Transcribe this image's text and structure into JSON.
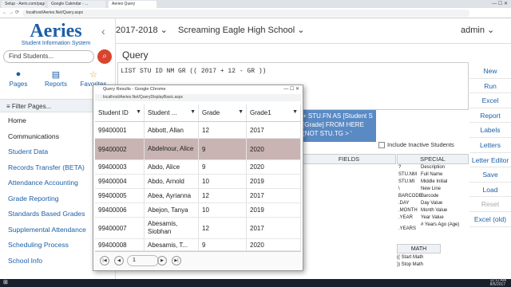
{
  "browser": {
    "tabs": [
      "Setup - Aeris.com/pages/...",
      "Google Calendar - ...",
      "Aeries Query"
    ],
    "url": "localhost/Aeries.Net/Query.aspx"
  },
  "sidebar": {
    "logo": "Aeries",
    "logo_sub": "Student Information System",
    "find_placeholder": "Find Students...",
    "quick": [
      {
        "label": "Pages"
      },
      {
        "label": "Reports"
      },
      {
        "label": "Favorites"
      }
    ],
    "filter_label": "Filter Pages...",
    "items": [
      {
        "label": "Home"
      },
      {
        "label": "Communications"
      },
      {
        "label": "Student Data"
      },
      {
        "label": "Records Transfer (BETA)"
      },
      {
        "label": "Attendance Accounting"
      },
      {
        "label": "Grade Reporting"
      },
      {
        "label": "Standards Based Grades"
      },
      {
        "label": "Supplemental Attendance"
      },
      {
        "label": "Scheduling Process"
      },
      {
        "label": "School Info"
      }
    ]
  },
  "topbar": {
    "year": "2017-2018",
    "school": "Screaming Eagle High School",
    "user": "admin"
  },
  "query": {
    "title": "Query",
    "text": "LIST STU ID NM GR (( 2017 + 12 - GR ))",
    "partial": "+ STU.FN AS [Student S [Grade] FROM HERE (NOT STU.TG > '",
    "include_inactive": "Include Inactive Students",
    "fields_header": "FIELDS",
    "special_header": "SPECIAL",
    "special": [
      {
        "k": "?",
        "v": "Description"
      },
      {
        "k": "STU.NM",
        "v": "Full Name"
      },
      {
        "k": "STU.MI",
        "v": "Middle Initial"
      },
      {
        "k": "\\",
        "v": "New Line"
      },
      {
        "k": "BARCODE",
        "v": "Barcode"
      },
      {
        "k": ".DAY",
        "v": "Day Value"
      },
      {
        "k": ".MONTH",
        "v": "Month Value"
      },
      {
        "k": ".YEAR",
        "v": "Year Value"
      },
      {
        "k": ".YEARS",
        "v": "# Years Ago (Age)"
      }
    ],
    "math_header": "MATH",
    "math": [
      "(( Start Math",
      ")) Stop Math"
    ]
  },
  "buttons": [
    "New",
    "Run",
    "Excel",
    "Report",
    "Labels",
    "Letters",
    "Letter Editor",
    "Save",
    "Load",
    "Reset",
    "Excel (old)"
  ],
  "popup": {
    "title": "Query Results - Google Chrome",
    "url": "localhost/Aeries.Net/QueryDisplayBasic.aspx",
    "columns": [
      "Student ID",
      "Student ...",
      "Grade",
      "Grade1"
    ],
    "rows": [
      {
        "id": "99400001",
        "name": "Abbott, Allan",
        "grade": "12",
        "grade1": "2017"
      },
      {
        "id": "99400002",
        "name": "Abdelnour, Alice",
        "grade": "9",
        "grade1": "2020"
      },
      {
        "id": "99400003",
        "name": "Abdo, Alice",
        "grade": "9",
        "grade1": "2020"
      },
      {
        "id": "99400004",
        "name": "Abdo, Arnold",
        "grade": "10",
        "grade1": "2019"
      },
      {
        "id": "99400005",
        "name": "Abea, Ayrianna",
        "grade": "12",
        "grade1": "2017"
      },
      {
        "id": "99400006",
        "name": "Abejon, Tanya",
        "grade": "10",
        "grade1": "2019"
      },
      {
        "id": "99400007",
        "name": "Abesamis, Siobhan",
        "grade": "12",
        "grade1": "2017"
      },
      {
        "id": "99400008",
        "name": "Abesamis, T...",
        "grade": "9",
        "grade1": "2020"
      }
    ],
    "page": "1"
  },
  "taskbar": {
    "time": "11:11 AM",
    "date": "8/5/2017"
  }
}
